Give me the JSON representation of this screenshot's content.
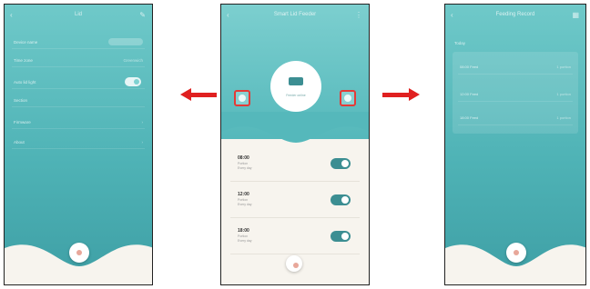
{
  "left_screen": {
    "title": "Lid",
    "rows": [
      {
        "label": "Device name",
        "value": ""
      },
      {
        "label": "Time zone",
        "value": "Greenwich"
      },
      {
        "label": "Auto lid light",
        "value": ""
      },
      {
        "label": "Section",
        "value": ""
      },
      {
        "label": "Firmware",
        "value": ""
      },
      {
        "label": "About",
        "value": ""
      }
    ]
  },
  "middle_screen": {
    "title": "Smart Lid Feeder",
    "device_caption": "Feeder online",
    "schedules": [
      {
        "time": "08:00",
        "line1": "Portion",
        "line2": "Every day"
      },
      {
        "time": "12:00",
        "line1": "Portion",
        "line2": "Every day"
      },
      {
        "time": "18:00",
        "line1": "Portion",
        "line2": "Every day"
      }
    ]
  },
  "right_screen": {
    "title": "Feeding Record",
    "subtitle": "Today",
    "rows": [
      {
        "label": "08:00 Feed",
        "value": "1 portion"
      },
      {
        "label": "12:00 Feed",
        "value": "1 portion"
      },
      {
        "label": "18:00 Feed",
        "value": "1 portion"
      }
    ]
  },
  "colors": {
    "teal_light": "#7ccfcf",
    "teal_dark": "#3e9fa5",
    "highlight": "#e53935",
    "arrow": "#e02020",
    "cream": "#f7f4ee"
  }
}
